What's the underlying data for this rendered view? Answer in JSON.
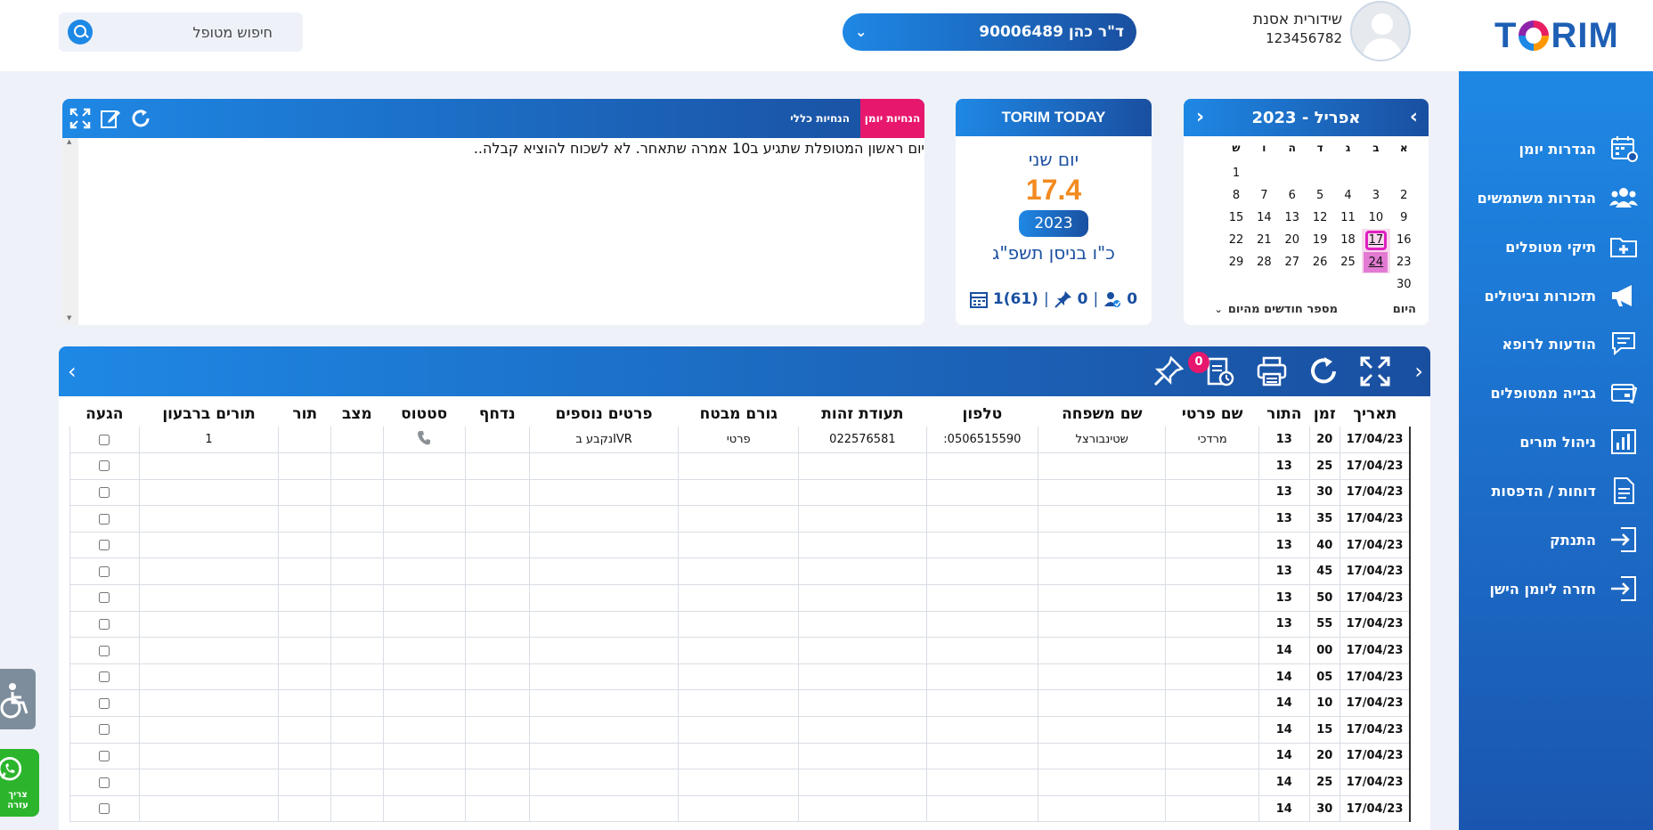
{
  "header": {
    "search_placeholder": "חיפוש מטופל",
    "doctor_select": "ד\"ר כהן 90006489",
    "user_name": "שידורית אסנת",
    "user_id": "123456782"
  },
  "sidebar": {
    "items": [
      {
        "label": "הגדרות יומן",
        "icon": "calendar-settings-icon"
      },
      {
        "label": "הגדרות משתמשים",
        "icon": "users-icon"
      },
      {
        "label": "תיקי מטופלים",
        "icon": "medical-folder-icon"
      },
      {
        "label": "תזכורות וביטולים",
        "icon": "megaphone-icon"
      },
      {
        "label": "הודעות לרופא",
        "icon": "chat-icon"
      },
      {
        "label": "גבייה ממטופלים",
        "icon": "payment-icon"
      },
      {
        "label": "ניהול תורים",
        "icon": "chart-icon"
      },
      {
        "label": "דוחות / הדפסות",
        "icon": "document-icon"
      },
      {
        "label": "התנתק",
        "icon": "logout-icon"
      },
      {
        "label": "חזרה ליומן הישן",
        "icon": "return-icon"
      }
    ]
  },
  "calendar": {
    "title": "אפריל - 2023",
    "days_of_week": [
      "א",
      "ב",
      "ג",
      "ד",
      "ה",
      "ו",
      "ש"
    ],
    "weeks": [
      [
        "",
        "",
        "",
        "",
        "",
        "",
        "1"
      ],
      [
        "2",
        "3",
        "4",
        "5",
        "6",
        "7",
        "8"
      ],
      [
        "9",
        "10",
        "11",
        "12",
        "13",
        "14",
        "15"
      ],
      [
        "16",
        "17",
        "18",
        "19",
        "20",
        "21",
        "22"
      ],
      [
        "23",
        "24",
        "25",
        "26",
        "27",
        "28",
        "29"
      ],
      [
        "30",
        "",
        "",
        "",
        "",
        "",
        ""
      ]
    ],
    "today_day": "17",
    "selected_day": "24",
    "today_link": "היום",
    "months_label": "מספר חודשים מהיום"
  },
  "today": {
    "title": "TORIM TODAY",
    "day_name": "יום שני",
    "date": "17.4",
    "year": "2023",
    "hebrew_date": "כ\"ו בניסן תשפ\"ג",
    "appointments": "1(61)",
    "pinned": "0",
    "patients": "0"
  },
  "notes": {
    "tab_journal": "הנחיות יומן",
    "tab_general": "הנחיות כללי",
    "text": "יום ראשון המטופלת שתגיע ב10 אמרה שתאחר. לא לשכוח להוציא קבלה.."
  },
  "table": {
    "notification_count": "0",
    "columns": [
      "תאריך",
      "זמן",
      "התור",
      "שם פרטי",
      "שם משפחה",
      "טלפון",
      "תעודת זהות",
      "גורם מבטח",
      "פרטים נוספים",
      "נדחף",
      "סטטוס",
      "מצב",
      "תור",
      "תורים ברבעון",
      "הגעה"
    ],
    "rows": [
      {
        "date": "17/04/23",
        "min": "20",
        "hour": "13",
        "first": "מרדכי",
        "last": "שטינבורצל",
        "phone": "0506515590:",
        "id": "022576581",
        "insurer": "פרטי",
        "extra": "IVRנקבע ב",
        "pushed": "",
        "status": "phone",
        "state": "",
        "turn": "",
        "quarter": "1"
      },
      {
        "date": "17/04/23",
        "min": "25",
        "hour": "13",
        "first": "",
        "last": "",
        "phone": "",
        "id": "",
        "insurer": "",
        "extra": "",
        "pushed": "",
        "status": "",
        "state": "",
        "turn": "",
        "quarter": ""
      },
      {
        "date": "17/04/23",
        "min": "30",
        "hour": "13",
        "first": "",
        "last": "",
        "phone": "",
        "id": "",
        "insurer": "",
        "extra": "",
        "pushed": "",
        "status": "",
        "state": "",
        "turn": "",
        "quarter": ""
      },
      {
        "date": "17/04/23",
        "min": "35",
        "hour": "13",
        "first": "",
        "last": "",
        "phone": "",
        "id": "",
        "insurer": "",
        "extra": "",
        "pushed": "",
        "status": "",
        "state": "",
        "turn": "",
        "quarter": ""
      },
      {
        "date": "17/04/23",
        "min": "40",
        "hour": "13",
        "first": "",
        "last": "",
        "phone": "",
        "id": "",
        "insurer": "",
        "extra": "",
        "pushed": "",
        "status": "",
        "state": "",
        "turn": "",
        "quarter": ""
      },
      {
        "date": "17/04/23",
        "min": "45",
        "hour": "13",
        "first": "",
        "last": "",
        "phone": "",
        "id": "",
        "insurer": "",
        "extra": "",
        "pushed": "",
        "status": "",
        "state": "",
        "turn": "",
        "quarter": ""
      },
      {
        "date": "17/04/23",
        "min": "50",
        "hour": "13",
        "first": "",
        "last": "",
        "phone": "",
        "id": "",
        "insurer": "",
        "extra": "",
        "pushed": "",
        "status": "",
        "state": "",
        "turn": "",
        "quarter": ""
      },
      {
        "date": "17/04/23",
        "min": "55",
        "hour": "13",
        "first": "",
        "last": "",
        "phone": "",
        "id": "",
        "insurer": "",
        "extra": "",
        "pushed": "",
        "status": "",
        "state": "",
        "turn": "",
        "quarter": ""
      },
      {
        "date": "17/04/23",
        "min": "00",
        "hour": "14",
        "first": "",
        "last": "",
        "phone": "",
        "id": "",
        "insurer": "",
        "extra": "",
        "pushed": "",
        "status": "",
        "state": "",
        "turn": "",
        "quarter": ""
      },
      {
        "date": "17/04/23",
        "min": "05",
        "hour": "14",
        "first": "",
        "last": "",
        "phone": "",
        "id": "",
        "insurer": "",
        "extra": "",
        "pushed": "",
        "status": "",
        "state": "",
        "turn": "",
        "quarter": ""
      },
      {
        "date": "17/04/23",
        "min": "10",
        "hour": "14",
        "first": "",
        "last": "",
        "phone": "",
        "id": "",
        "insurer": "",
        "extra": "",
        "pushed": "",
        "status": "",
        "state": "",
        "turn": "",
        "quarter": ""
      },
      {
        "date": "17/04/23",
        "min": "15",
        "hour": "14",
        "first": "",
        "last": "",
        "phone": "",
        "id": "",
        "insurer": "",
        "extra": "",
        "pushed": "",
        "status": "",
        "state": "",
        "turn": "",
        "quarter": ""
      },
      {
        "date": "17/04/23",
        "min": "20",
        "hour": "14",
        "first": "",
        "last": "",
        "phone": "",
        "id": "",
        "insurer": "",
        "extra": "",
        "pushed": "",
        "status": "",
        "state": "",
        "turn": "",
        "quarter": ""
      },
      {
        "date": "17/04/23",
        "min": "25",
        "hour": "14",
        "first": "",
        "last": "",
        "phone": "",
        "id": "",
        "insurer": "",
        "extra": "",
        "pushed": "",
        "status": "",
        "state": "",
        "turn": "",
        "quarter": ""
      },
      {
        "date": "17/04/23",
        "min": "30",
        "hour": "14",
        "first": "",
        "last": "",
        "phone": "",
        "id": "",
        "insurer": "",
        "extra": "",
        "pushed": "",
        "status": "",
        "state": "",
        "turn": "",
        "quarter": ""
      }
    ]
  },
  "floating": {
    "help_text": "צריך עזרה",
    "whatsapp_icon": "whatsapp-icon",
    "accessibility_icon": "accessibility-icon"
  },
  "colors": {
    "primary_blue": "#1e88e5",
    "dark_blue": "#1a4fa0",
    "accent_pink": "#e8176e",
    "accent_orange": "#f28b20",
    "whatsapp_green": "#2cb52c"
  }
}
